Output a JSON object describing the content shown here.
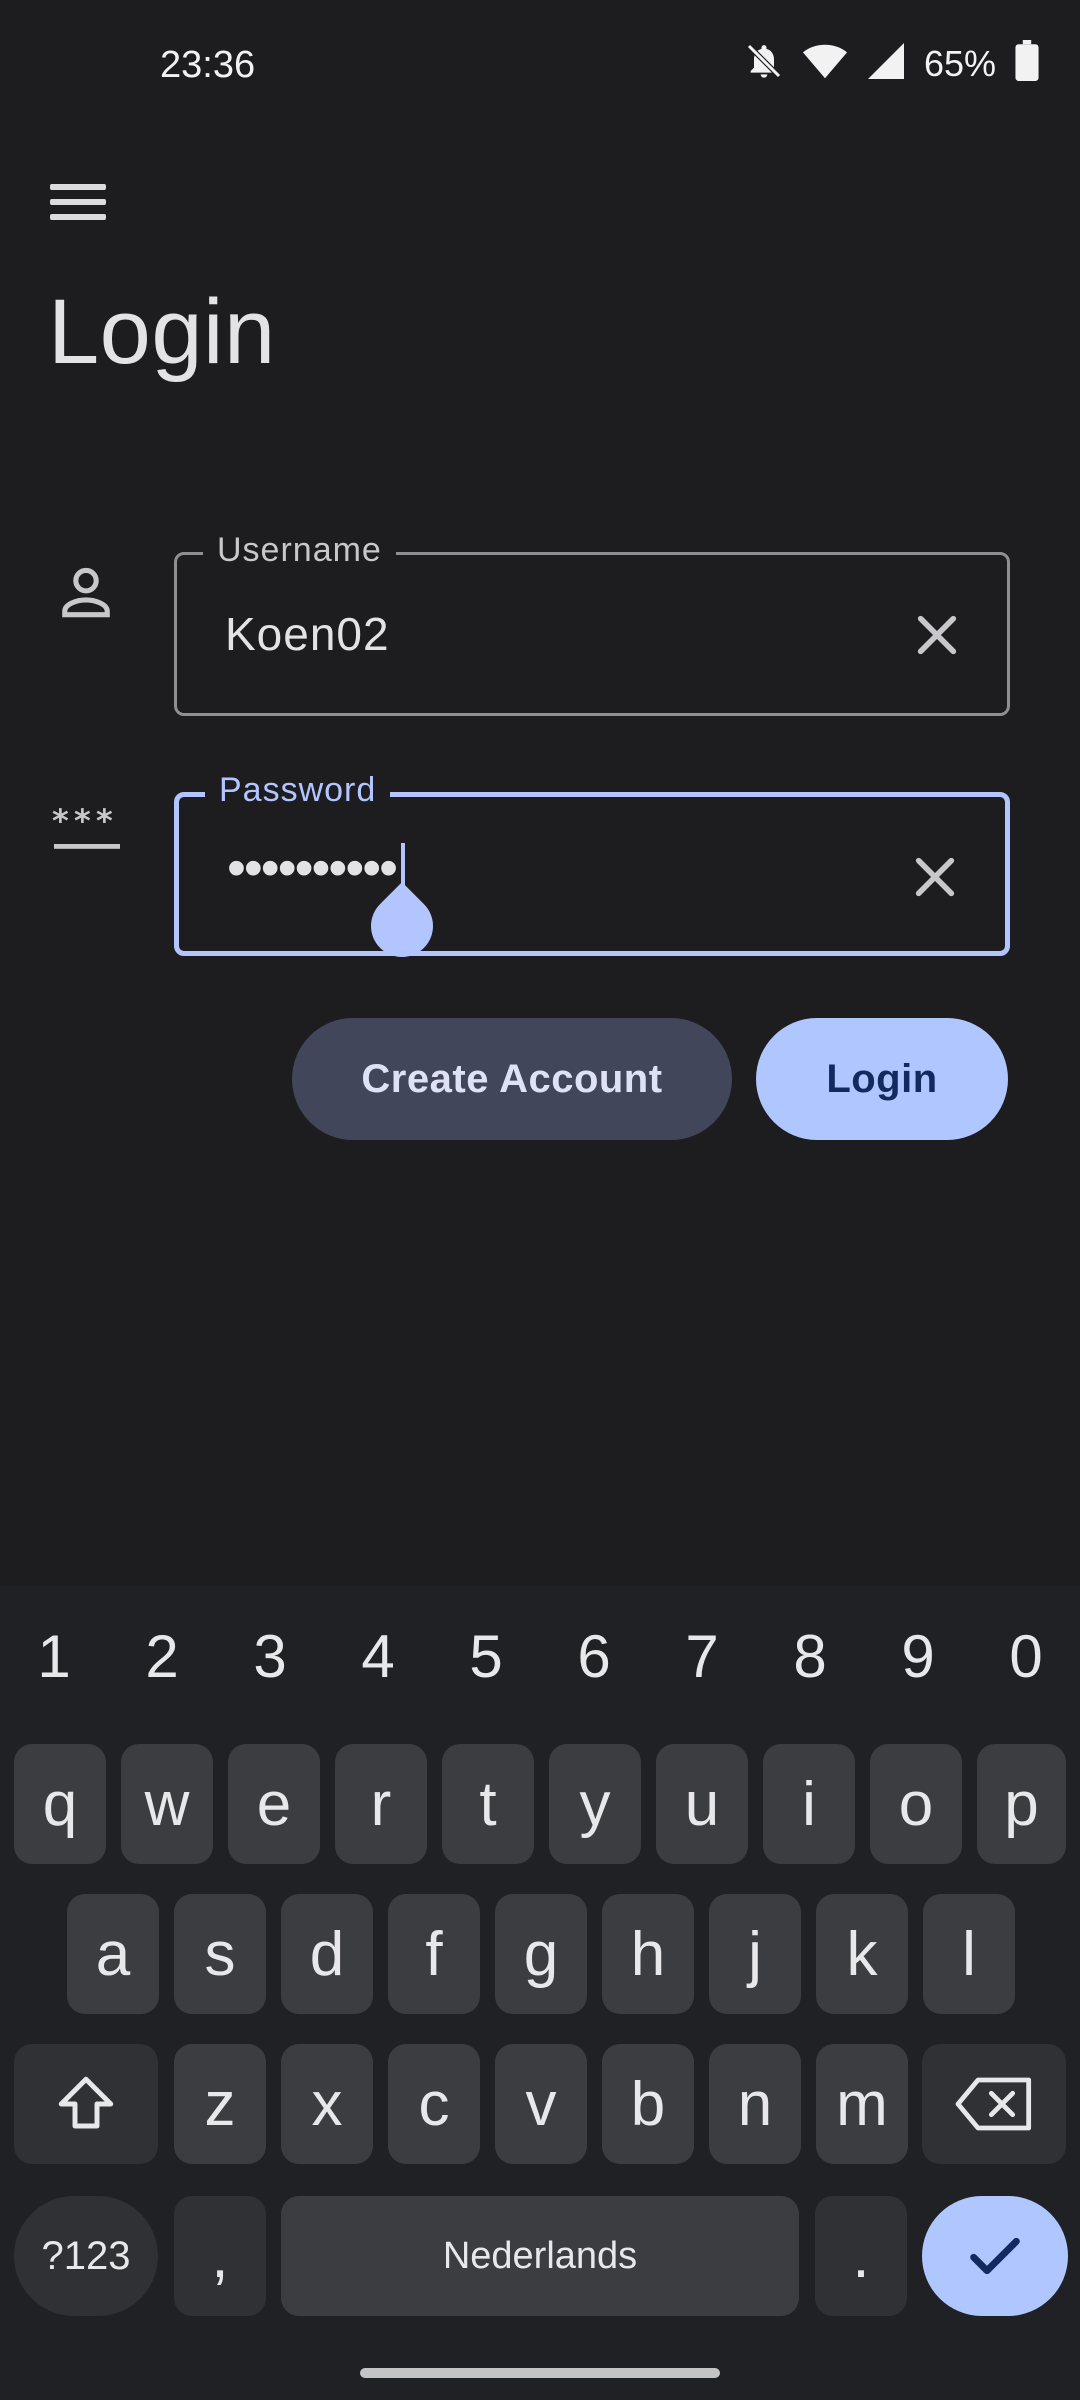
{
  "status": {
    "time": "23:36",
    "battery": "65%"
  },
  "page": {
    "title": "Login"
  },
  "username": {
    "label": "Username",
    "value": "Koen02"
  },
  "password": {
    "label": "Password",
    "masked": "••••••••••"
  },
  "buttons": {
    "create_account": "Create Account",
    "login": "Login"
  },
  "keyboard": {
    "numbers": [
      "1",
      "2",
      "3",
      "4",
      "5",
      "6",
      "7",
      "8",
      "9",
      "0"
    ],
    "row1": [
      "q",
      "w",
      "e",
      "r",
      "t",
      "y",
      "u",
      "i",
      "o",
      "p"
    ],
    "row2": [
      "a",
      "s",
      "d",
      "f",
      "g",
      "h",
      "j",
      "k",
      "l"
    ],
    "row3": [
      "z",
      "x",
      "c",
      "v",
      "b",
      "n",
      "m"
    ],
    "symbols": "?123",
    "comma": ",",
    "space": "Nederlands",
    "period": "."
  },
  "colors": {
    "accent": "#b3c5ff",
    "background": "#1d1d20",
    "secondary_button": "#41465a"
  }
}
